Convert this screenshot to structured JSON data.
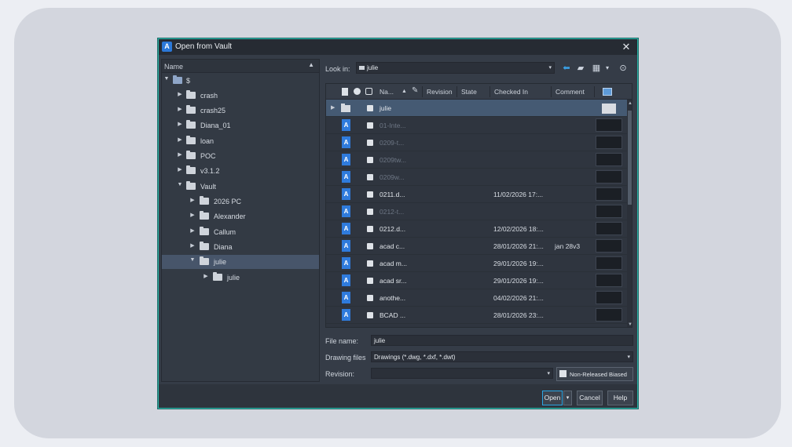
{
  "dialog": {
    "title": "Open from Vault",
    "app_icon": "A"
  },
  "tree": {
    "header": "Name",
    "nodes": [
      {
        "label": "$",
        "expanded": true
      },
      {
        "label": "crash"
      },
      {
        "label": "crash25"
      },
      {
        "label": "Diana_01"
      },
      {
        "label": "loan"
      },
      {
        "label": "POC"
      },
      {
        "label": "v3.1.2"
      },
      {
        "label": "Vault",
        "expanded": true
      },
      {
        "label": "2026 PC"
      },
      {
        "label": "Alexander"
      },
      {
        "label": "Callum"
      },
      {
        "label": "Diana"
      },
      {
        "label": "julie",
        "expanded": true,
        "selected": true
      },
      {
        "label": "julie"
      }
    ]
  },
  "lookin": {
    "label": "Look in:",
    "value": "julie"
  },
  "toolbar": {
    "icons": [
      "back-arrow-icon",
      "up-folder-icon",
      "view-grid-icon",
      "view-dropdown-icon",
      "options-icon"
    ]
  },
  "grid": {
    "columns": {
      "name": "Na...",
      "revision": "Revision",
      "state": "State",
      "checked_in": "Checked In",
      "comment": "Comment"
    },
    "rows": [
      {
        "name": "julie",
        "type": "folder",
        "selected": true
      },
      {
        "name": "01-Inte...",
        "type": "file",
        "dim": true
      },
      {
        "name": "0209-t...",
        "type": "file",
        "dim": true
      },
      {
        "name": "0209tw...",
        "type": "file",
        "dim": true
      },
      {
        "name": "0209w...",
        "type": "file",
        "dim": true
      },
      {
        "name": "0211.d...",
        "type": "file",
        "checked_in": "11/02/2026 17:..."
      },
      {
        "name": "0212-t...",
        "type": "file",
        "dim": true
      },
      {
        "name": "0212.d...",
        "type": "file",
        "checked_in": "12/02/2026 18:..."
      },
      {
        "name": "acad c...",
        "type": "file",
        "checked_in": "28/01/2026 21:...",
        "comment": "jan 28v3"
      },
      {
        "name": "acad m...",
        "type": "file",
        "checked_in": "29/01/2026 19:..."
      },
      {
        "name": "acad sr...",
        "type": "file",
        "checked_in": "29/01/2026 19:..."
      },
      {
        "name": "anothe...",
        "type": "file",
        "checked_in": "04/02/2026 21:..."
      },
      {
        "name": "BCAD ...",
        "type": "file",
        "checked_in": "28/01/2026 23:..."
      }
    ]
  },
  "fields": {
    "file_name_label": "File name:",
    "file_name_value": "julie",
    "drawing_files_label": "Drawing files",
    "drawing_files_value": "Drawings (*.dwg, *.dxf, *.dwt)",
    "revision_label": "Revision:",
    "revision_value": ""
  },
  "buttons": {
    "non_released": "Non-Released Biased",
    "open": "Open",
    "cancel": "Cancel",
    "help": "Help"
  },
  "colors": {
    "accent": "#2ab3a6",
    "selection": "#455a73",
    "file_icon": "#2f7bdc"
  }
}
